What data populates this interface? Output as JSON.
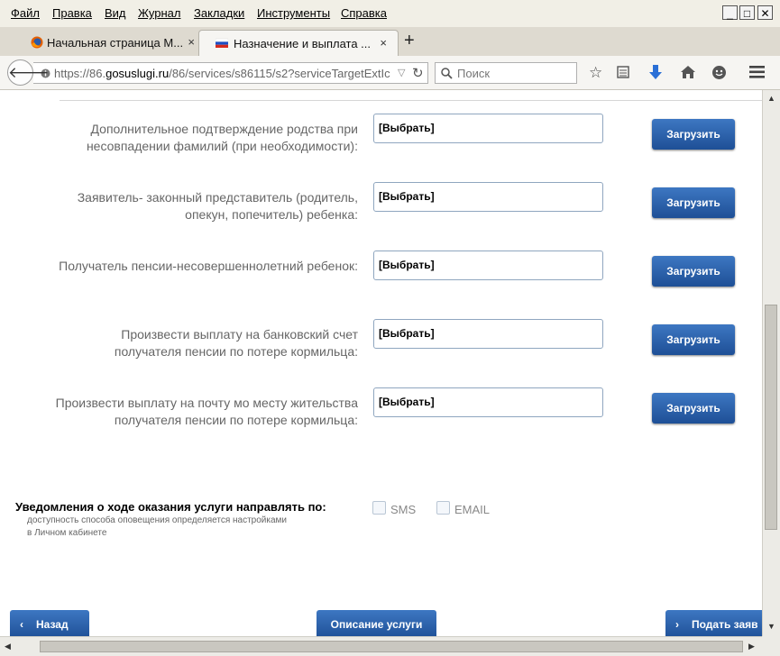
{
  "menu": {
    "items": [
      "Файл",
      "Правка",
      "Вид",
      "Журнал",
      "Закладки",
      "Инструменты",
      "Справка"
    ]
  },
  "window_controls": {
    "minimize": "_",
    "maximize": "□",
    "close": "✕"
  },
  "tabs": [
    {
      "title": "Начальная страница М...",
      "icon": "firefox-icon",
      "active": false
    },
    {
      "title": "Назначение и выплата ...",
      "icon": "russia-flag-icon",
      "active": true
    }
  ],
  "tab_close": "×",
  "new_tab": "+",
  "navbar": {
    "url_prefix": "https://86.",
    "url_domain": "gosuslugi.ru",
    "url_rest": "/86/services/s86115/s2?serviceTargetExtIc",
    "search_placeholder": "Поиск"
  },
  "rows": [
    {
      "label": "Дополнительное подтверждение родства при несовпадении фамилий (при необходимости):",
      "select": "[Выбрать]",
      "button": "Загрузить"
    },
    {
      "label": "Заявитель- законный представитель (родитель, опекун, попечитель) ребенка:",
      "select": "[Выбрать]",
      "button": "Загрузить"
    },
    {
      "label": "Получатель пенсии-несовершеннолетний ребенок:",
      "select": "[Выбрать]",
      "button": "Загрузить"
    },
    {
      "label": "Произвести выплату на банковский счет получателя пенсии по потере кормильца:",
      "select": "[Выбрать]",
      "button": "Загрузить"
    },
    {
      "label": "Произвести выплату на почту мо месту жительства получателя пенсии по потере кормильца:",
      "select": "[Выбрать]",
      "button": "Загрузить"
    }
  ],
  "notifications": {
    "title": "Уведомления о ходе оказания услуги направлять по:",
    "note": "доступность способа оповещения определяется настройками в Личном кабинете",
    "sms_label": "SMS",
    "email_label": "EMAIL",
    "sms_checked": false,
    "email_checked": false
  },
  "footer": {
    "back": "Назад",
    "description": "Описание услуги",
    "submit": "Подать заяв"
  },
  "colors": {
    "button_blue": "#1e4f96",
    "accent": "#3d77c2"
  }
}
